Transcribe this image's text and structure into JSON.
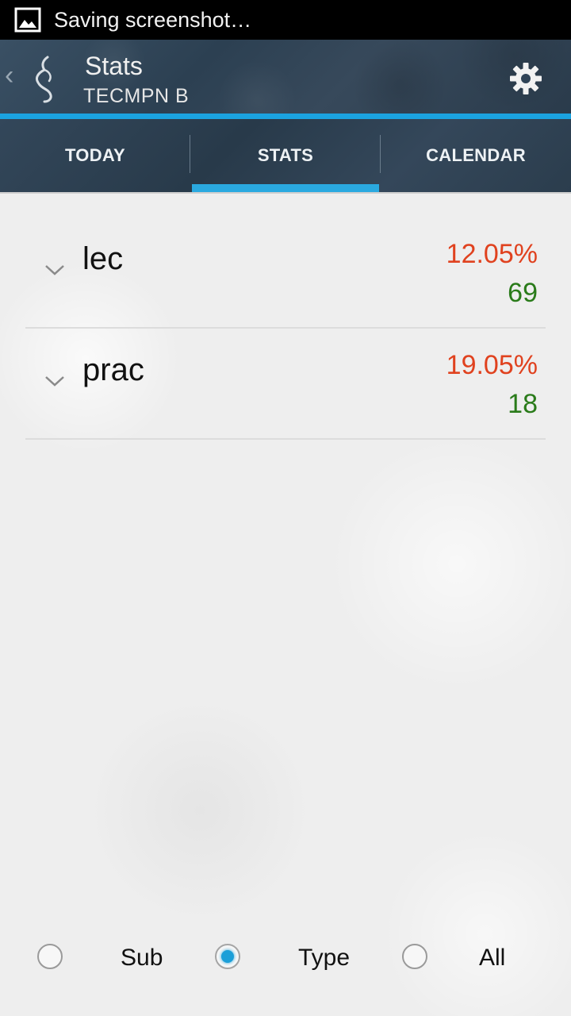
{
  "status_bar": {
    "icon": "image-icon",
    "text": "Saving screenshot…"
  },
  "action_bar": {
    "up_icon": "chevron-left-icon",
    "logo_icon": "app-logo-icon",
    "title": "Stats",
    "subtitle": "TECMPN B",
    "settings_icon": "gear-icon",
    "accent_color": "#1ba3e0"
  },
  "tabs": [
    {
      "label": "TODAY",
      "selected": false
    },
    {
      "label": "STATS",
      "selected": true
    },
    {
      "label": "CALENDAR",
      "selected": false
    }
  ],
  "stats": [
    {
      "name": "lec",
      "percent": "12.05%",
      "count": "69",
      "expand_icon": "chevron-down-icon"
    },
    {
      "name": "prac",
      "percent": "19.05%",
      "count": "18",
      "expand_icon": "chevron-down-icon"
    }
  ],
  "colors": {
    "percent": "#e0421f",
    "count": "#2a7b1a",
    "radio_selected": "#1b9fd8"
  },
  "filter": {
    "options": [
      {
        "label": "Sub",
        "selected": false
      },
      {
        "label": "Type",
        "selected": true
      },
      {
        "label": "All",
        "selected": false
      }
    ]
  }
}
